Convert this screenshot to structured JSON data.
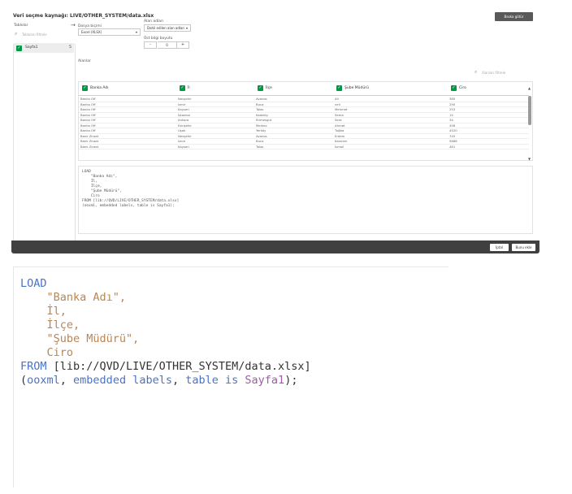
{
  "dialog": {
    "title": "Veri seçme kaynağı: LIVE/OTHER_SYSTEM/data.xlsx",
    "top_button": "Baska götür"
  },
  "tables": {
    "label": "Tablolar",
    "search_placeholder": "Tabloları filtrele",
    "items": [
      {
        "name": "Sayfa1",
        "count": "5"
      }
    ]
  },
  "options": {
    "file_format_label": "Dosya biçimi",
    "file_format_value": "Excel (XLSX)",
    "field_names_label": "Alan adları",
    "field_names_value": "Dahil edilen alan adları",
    "header_size_label": "Üst bilgi boyutu",
    "header_size_value": "0",
    "minus": "-",
    "plus": "+"
  },
  "fields": {
    "label": "Alanlar",
    "search_placeholder": "Alanları filtrele",
    "columns": [
      "Banka Adı",
      "İl",
      "İlçe",
      "Şube Müdürü",
      "Ciro"
    ],
    "rows": [
      [
        "Banka Off",
        "Nevşehir",
        "Avanos",
        "Ali",
        "385"
      ],
      [
        "Banka Off",
        "İzmir",
        "Buca",
        "veli",
        "290"
      ],
      [
        "Banka Off",
        "Kayseri",
        "Talas",
        "Mehmet",
        "253"
      ],
      [
        "Banka Off",
        "İstanbul",
        "Kadıköy",
        "Sema",
        "15"
      ],
      [
        "Banka Off",
        "Ankara",
        "Etimesgut",
        "Sera",
        "34"
      ],
      [
        "Banka Off",
        "Eskişehir",
        "Merkez",
        "Ahmet",
        "456"
      ],
      [
        "Banka Off",
        "Uşak",
        "Yerköy",
        "Tuğba",
        "4520"
      ],
      [
        "Bank Ziraat",
        "Nevşehir",
        "Avanos",
        "Erdem",
        "745"
      ],
      [
        "Bank Ziraat",
        "İzmir",
        "Buca",
        "Kandırık",
        "5888"
      ],
      [
        "Bank Ziraat",
        "Kayseri",
        "Talas",
        "İsmail",
        "481"
      ]
    ]
  },
  "script_preview": "LOAD\n    \"Banka Adı\",\n    İl,\n    İlçe,\n    \"Şube Müdürü\",\n    Ciro\nFROM [lib://QVD/LIVE/OTHER_SYSTEM/data.xlsx]\n(ooxml, embedded labels, table is Sayfa1);",
  "footer": {
    "cancel": "İptal",
    "insert": "Bunu ekle"
  },
  "zoom": {
    "load": "LOAD",
    "f1": "\"Banka Adı\",",
    "f2": "İl,",
    "f3": "İlçe,",
    "f4": "\"Şube Müdürü\",",
    "f5": "Ciro",
    "from": "FROM",
    "path": " [lib://QVD/LIVE/OTHER_SYSTEM/data.xlsx]",
    "open_paren": "(",
    "ooxml": "ooxml",
    "comma1": ", ",
    "embedded_labels": "embedded labels",
    "comma2": ", ",
    "table_is": "table is",
    "space": " ",
    "sheet": "Sayfa1",
    "close": ");"
  },
  "colors": {
    "accent_green": "#009845",
    "keyword_blue": "#4a73c5",
    "string_brown": "#b88655",
    "table_purple": "#a05ca8",
    "footer_dark": "#404040"
  },
  "icons": {
    "search": "search-icon",
    "check": "check-icon",
    "arrow": "arrow-right-icon",
    "caret": "chevron-down-icon"
  }
}
